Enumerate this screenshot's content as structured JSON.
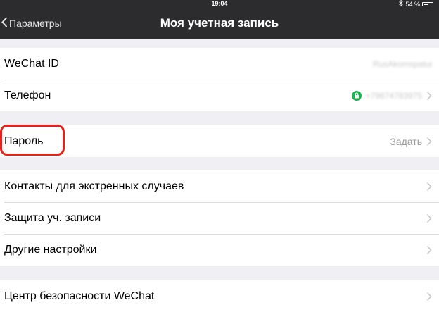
{
  "status_bar": {
    "time": "19:04",
    "battery": "54 %"
  },
  "nav": {
    "back_label": "Параметры",
    "title": "Моя учетная запись"
  },
  "group1": [
    {
      "label": "WeChat ID",
      "value": "RusAkomspatui"
    },
    {
      "label": "Телефон",
      "value": "+79874783975"
    }
  ],
  "group2": [
    {
      "label": "Пароль",
      "value": "Задать"
    }
  ],
  "group3": [
    {
      "label": "Контакты для экстренных случаев"
    },
    {
      "label": "Защита уч. записи"
    },
    {
      "label": "Другие настройки"
    }
  ],
  "group4": [
    {
      "label": "Центр безопасности WeChat"
    }
  ],
  "colors": {
    "nav_bg": "#2c2c2e",
    "highlight": "#e8211a",
    "lock_green": "#1ab34f",
    "background": "#efeff4"
  }
}
